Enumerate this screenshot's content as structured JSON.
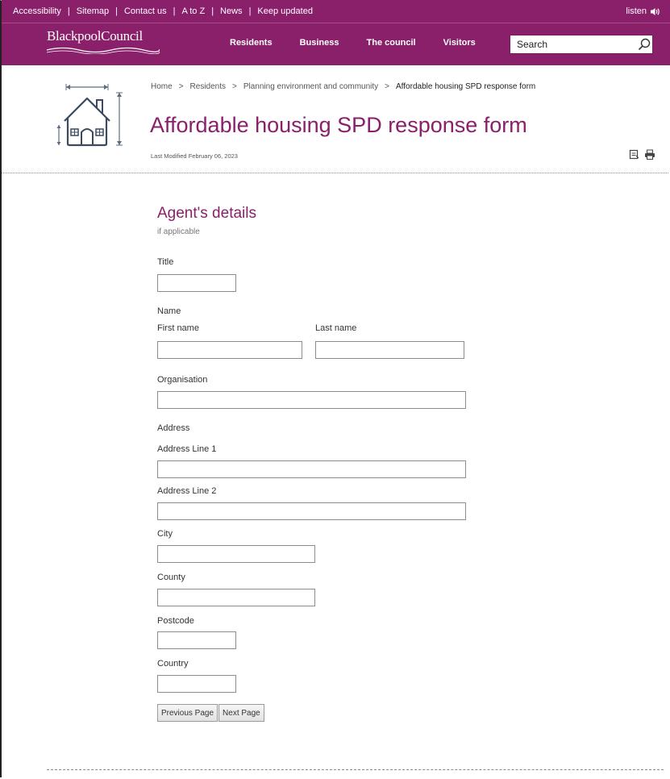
{
  "utility_bar": {
    "links": [
      "Accessibility",
      "Sitemap",
      "Contact us",
      "A to Z",
      "News",
      "Keep updated"
    ],
    "separator": "|",
    "listen_label": "listen"
  },
  "header": {
    "logo_text": "BlackpoolCouncil",
    "nav": [
      "Residents",
      "Business",
      "The council",
      "Visitors"
    ],
    "search_placeholder": "Search"
  },
  "breadcrumb": {
    "items": [
      "Home",
      "Residents",
      "Planning environment and community"
    ],
    "current": "Affordable housing SPD response form",
    "separator": ">"
  },
  "page": {
    "title": "Affordable housing SPD response form",
    "last_modified": "Last Modified February 06, 2023"
  },
  "form": {
    "section_title": "Agent's details",
    "section_subtitle": "if applicable",
    "title_label": "Title",
    "name_label": "Name",
    "first_name_label": "First name",
    "last_name_label": "Last name",
    "organisation_label": "Organisation",
    "address_label": "Address",
    "address_line1_label": "Address Line 1",
    "address_line2_label": "Address Line 2",
    "city_label": "City",
    "county_label": "County",
    "postcode_label": "Postcode",
    "country_label": "Country",
    "values": {
      "title": "",
      "first_name": "",
      "last_name": "",
      "organisation": "",
      "address_line1": "",
      "address_line2": "",
      "city": "",
      "county": "",
      "postcode": "",
      "country": ""
    },
    "previous_button": "Previous Page",
    "next_button": "Next Page"
  },
  "colors": {
    "brand": "#8a1f6a",
    "text": "#333333",
    "border": "#8c8c8c"
  },
  "icons": [
    "speaker-icon",
    "search-icon",
    "house-icon",
    "save-page-icon",
    "print-icon"
  ]
}
